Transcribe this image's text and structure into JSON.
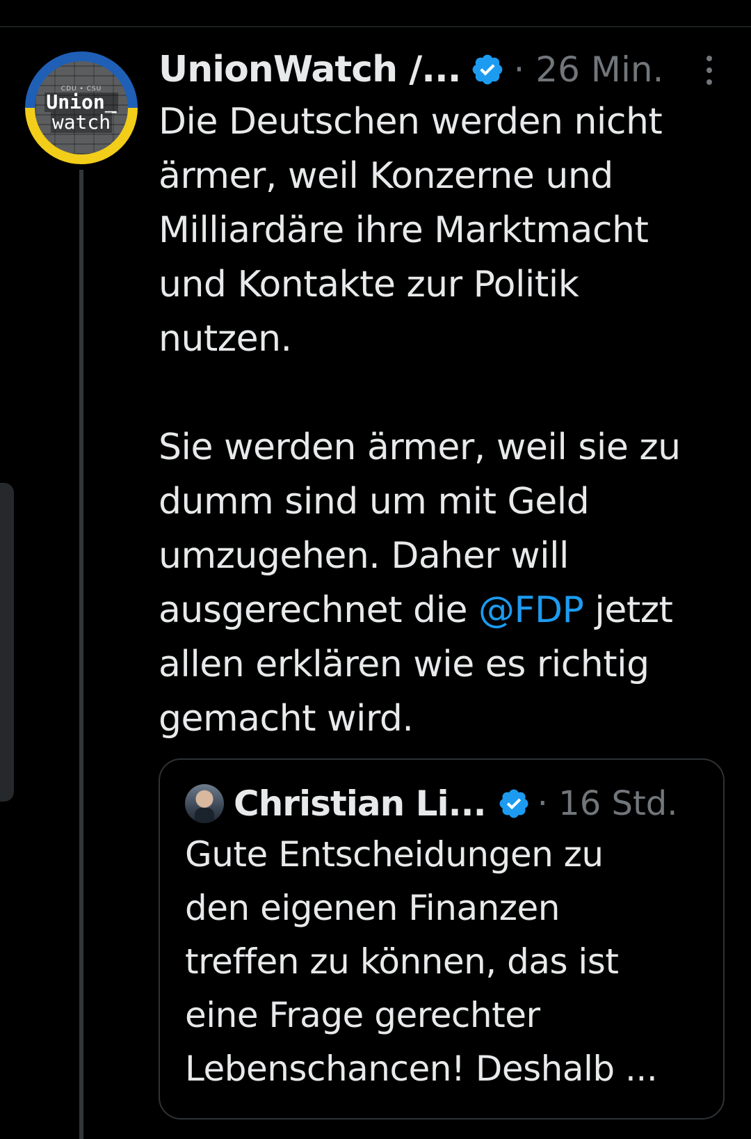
{
  "colors": {
    "background": "#000000",
    "text": "#e7e9ea",
    "muted": "#71767b",
    "accent": "#1d9bf0",
    "border": "#2f3336"
  },
  "tweet": {
    "avatar": {
      "small_text": "CDU • CSU",
      "line1": "Union_",
      "line2": "watch"
    },
    "author_name": "UnionWatch /...",
    "verified_icon": "verified-badge-icon",
    "separator": "·",
    "time": "26 Min.",
    "more_icon": "more-vertical-icon",
    "text_lines": [
      "Die Deutschen werden nicht",
      "ärmer, weil Konzerne und",
      "Milliardäre ihre Marktmacht",
      "und Kontakte zur Politik",
      "nutzen.",
      "",
      "Sie werden ärmer, weil sie zu",
      "dumm sind um mit Geld",
      "umzugehen. Daher will"
    ],
    "mention_line": {
      "before": "ausgerechnet die ",
      "mention": "@FDP",
      "after": " jetzt"
    },
    "text_lines_end": [
      "allen erklären wie es richtig",
      "gemacht wird."
    ]
  },
  "quote": {
    "author_name": "Christian Li...",
    "verified_icon": "verified-badge-icon",
    "separator": "·",
    "time": "16 Std.",
    "text_lines": [
      "Gute Entscheidungen zu",
      "den eigenen Finanzen",
      "treffen zu können, das ist",
      "eine Frage gerechter",
      "Lebenschancen! Deshalb ..."
    ]
  }
}
